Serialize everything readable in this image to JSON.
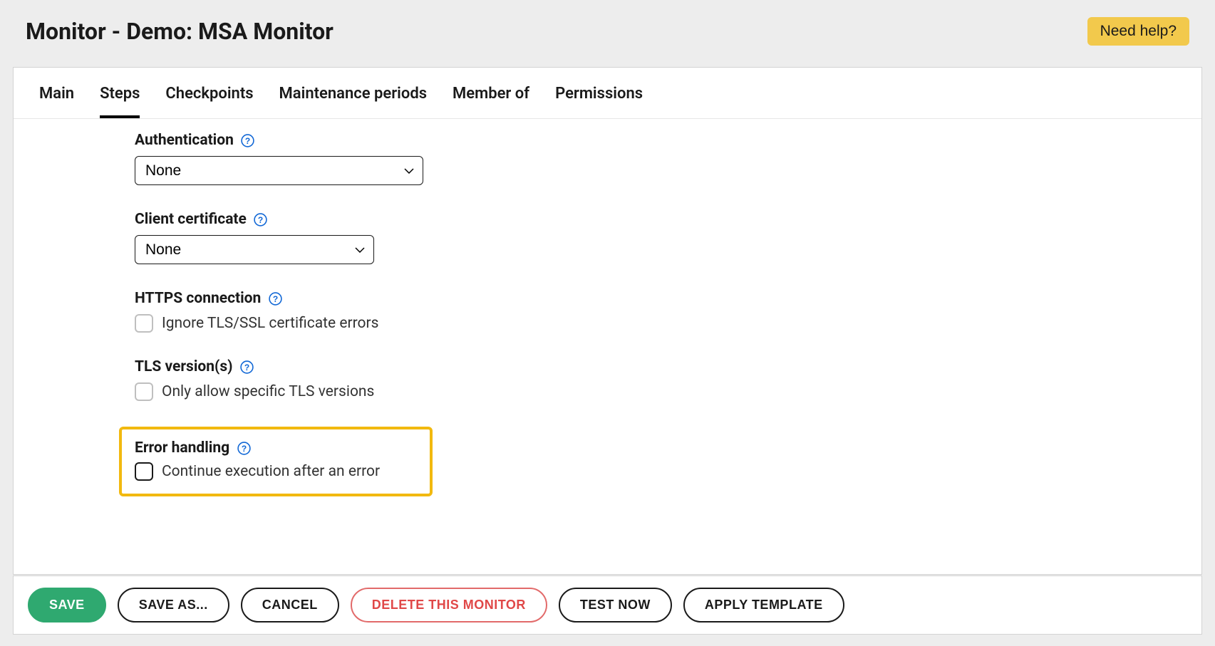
{
  "header": {
    "title": "Monitor - Demo: MSA Monitor",
    "help_button": "Need help?"
  },
  "tabs": {
    "items": [
      {
        "label": "Main",
        "active": false
      },
      {
        "label": "Steps",
        "active": true
      },
      {
        "label": "Checkpoints",
        "active": false
      },
      {
        "label": "Maintenance periods",
        "active": false
      },
      {
        "label": "Member of",
        "active": false
      },
      {
        "label": "Permissions",
        "active": false
      }
    ]
  },
  "form": {
    "authentication": {
      "label": "Authentication",
      "value": "None"
    },
    "client_certificate": {
      "label": "Client certificate",
      "value": "None"
    },
    "https_connection": {
      "label": "HTTPS connection",
      "checkbox_label": "Ignore TLS/SSL certificate errors"
    },
    "tls_versions": {
      "label": "TLS version(s)",
      "checkbox_label": "Only allow specific TLS versions"
    },
    "error_handling": {
      "label": "Error handling",
      "checkbox_label": "Continue execution after an error"
    }
  },
  "footer": {
    "save": "SAVE",
    "save_as": "SAVE AS...",
    "cancel": "CANCEL",
    "delete": "DELETE THIS MONITOR",
    "test_now": "TEST NOW",
    "apply_template": "APPLY TEMPLATE"
  }
}
